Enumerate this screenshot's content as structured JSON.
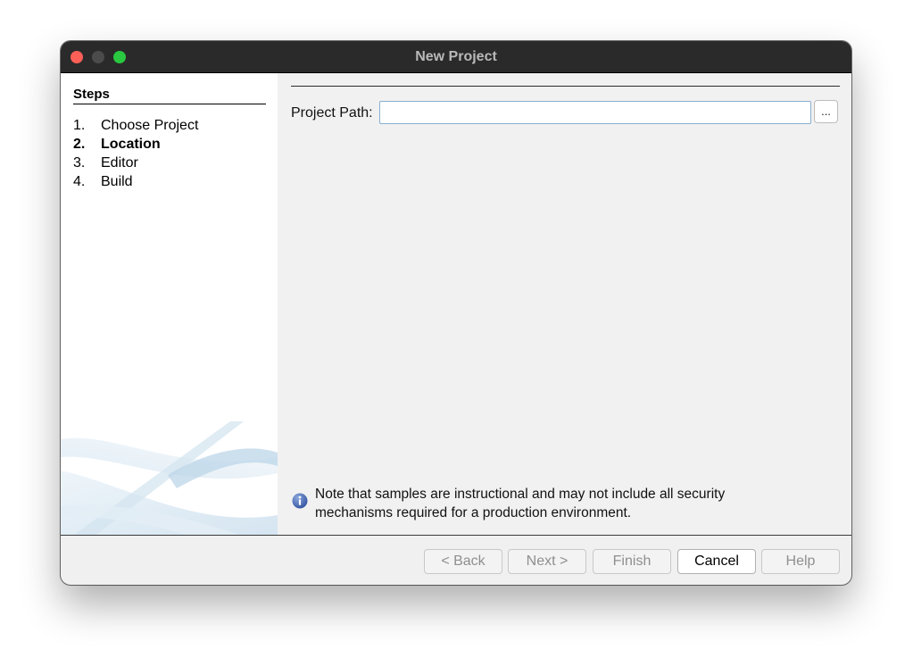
{
  "window": {
    "title": "New Project"
  },
  "steps": {
    "title": "Steps",
    "items": [
      {
        "num": "1.",
        "label": "Choose Project",
        "current": false
      },
      {
        "num": "2.",
        "label": "Location",
        "current": true
      },
      {
        "num": "3.",
        "label": "Editor",
        "current": false
      },
      {
        "num": "4.",
        "label": "Build",
        "current": false
      }
    ]
  },
  "form": {
    "project_path_label": "Project Path:",
    "project_path_value": "",
    "browse_label": "..."
  },
  "note": {
    "text": "Note that samples are instructional and may not include all security mechanisms required for a production environment."
  },
  "buttons": {
    "back": "< Back",
    "next": "Next >",
    "finish": "Finish",
    "cancel": "Cancel",
    "help": "Help"
  },
  "colors": {
    "titlebar": "#2a2a2a",
    "close": "#fe5f57",
    "minimize": "#4b4b4b",
    "zoom": "#2ac840",
    "input_border": "#8aaed0",
    "info_icon": "#3c5ba9"
  },
  "icons": {
    "info": "info-icon",
    "watermark": "swoosh-watermark"
  }
}
